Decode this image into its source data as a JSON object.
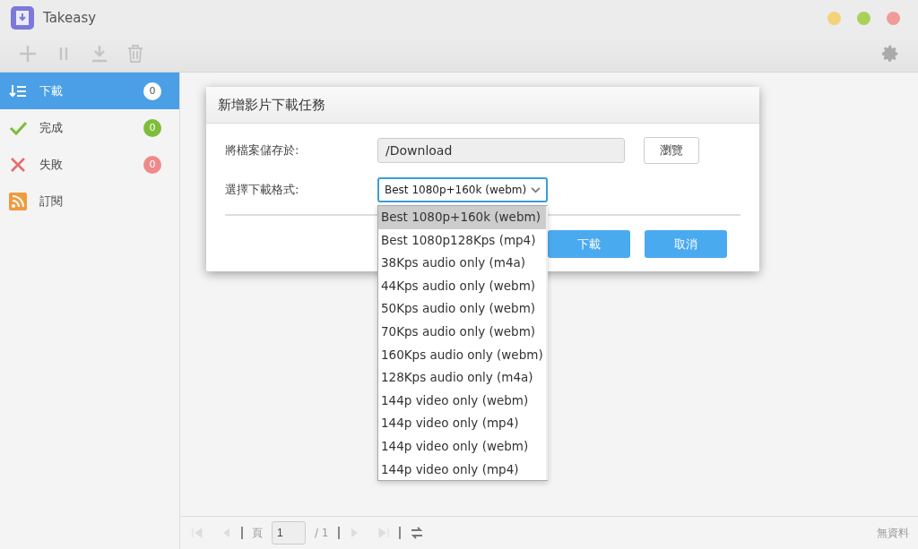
{
  "window": {
    "title": "Takeasy",
    "controls": [
      {
        "color": "#f4d27a"
      },
      {
        "color": "#a9d15a"
      },
      {
        "color": "#f19a9a"
      }
    ]
  },
  "toolbar": {
    "buttons": [
      {
        "kind": "add",
        "disabled": true
      },
      {
        "kind": "pause",
        "disabled": true
      },
      {
        "kind": "download",
        "disabled": true
      },
      {
        "kind": "delete",
        "disabled": true
      }
    ]
  },
  "sidebar": {
    "items": [
      {
        "kind": "downloading",
        "label": "下載",
        "count": "0",
        "selected": true,
        "color": "#ffffff"
      },
      {
        "kind": "done",
        "label": "完成",
        "count": "0",
        "selected": false,
        "color": "#7dbd3a"
      },
      {
        "kind": "failed",
        "label": "失敗",
        "count": "0",
        "selected": false,
        "color": "#ee8a8a"
      },
      {
        "kind": "rss",
        "label": "訂閱",
        "selected": false
      }
    ]
  },
  "dialog": {
    "title": "新增影片下載任務",
    "save_label": "將檔案儲存於:",
    "save_path": "/Download",
    "browse_button": "瀏覽",
    "format_label": "選擇下載格式:",
    "format_value": "Best 1080p+160k (webm)",
    "format_options": [
      {
        "label": "Best 1080p+160k (webm)",
        "selected": true
      },
      {
        "label": "Best 1080p128Kps (mp4)",
        "selected": false
      },
      {
        "label": "38Kps audio only (m4a)",
        "selected": false
      },
      {
        "label": "44Kps audio only (webm)",
        "selected": false
      },
      {
        "label": "50Kps audio only (webm)",
        "selected": false
      },
      {
        "label": "70Kps audio only (webm)",
        "selected": false
      },
      {
        "label": "160Kps audio only (webm)",
        "selected": false
      },
      {
        "label": "128Kps audio only (m4a)",
        "selected": false
      },
      {
        "label": "144p video only (webm)",
        "selected": false
      },
      {
        "label": "144p video only (mp4)",
        "selected": false
      },
      {
        "label": "144p video only (webm)",
        "selected": false
      },
      {
        "label": "144p video only (mp4)",
        "selected": false
      }
    ],
    "buttons": [
      "下載",
      "取消"
    ]
  },
  "pager": {
    "page_label": "頁",
    "page": "1",
    "total": "/ 1",
    "status": "無資料"
  }
}
